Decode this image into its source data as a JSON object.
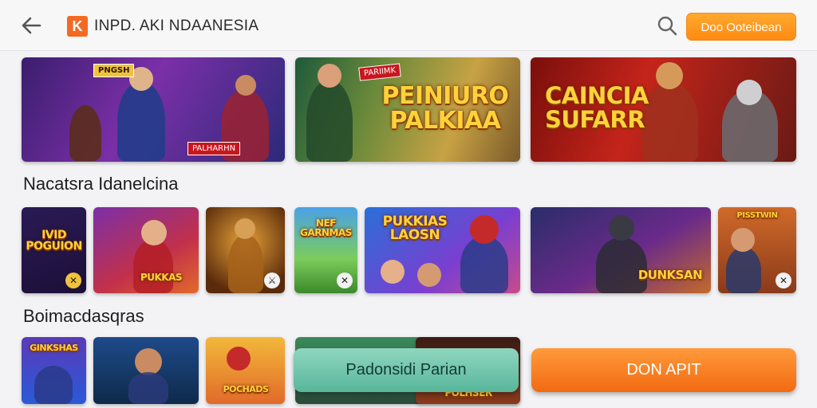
{
  "header": {
    "logo_letter": "K",
    "brand": "INPD. AKI NDAANESIA",
    "cta_label": "Doo Ooteibean"
  },
  "banners": [
    {
      "tag": "PNGSH",
      "badge": "PALHARHN"
    },
    {
      "tag": "PARIIMK",
      "title": "PEINIURO\nPALKIAA"
    },
    {
      "title": "CAINCIA\nSUFARR"
    }
  ],
  "sections": [
    {
      "title": "Nacatsra Idanelcina"
    },
    {
      "title": "Boimacdasqras"
    }
  ],
  "row2": [
    {
      "title": "IVID\nPOGUION"
    },
    {
      "title": "PUKKAS"
    },
    {
      "title": ""
    },
    {
      "title": "NEF\nGARNMAS"
    },
    {
      "title": "PUKKIAS\nLAOSN"
    },
    {
      "title": "DUNKSAN"
    },
    {
      "title": "PISSTWIN"
    }
  ],
  "row3": [
    {
      "title": "GINKSHAS"
    },
    {
      "title": ""
    },
    {
      "title": "POCHADS"
    },
    {
      "title": ""
    },
    {
      "title": "POLHSER"
    }
  ],
  "buttons": {
    "secondary": "Padonsidi Parian",
    "primary": "DON APIT"
  },
  "colors": {
    "accent": "#ff8a12",
    "teal": "#58b69a"
  },
  "icons": [
    "back-arrow-icon",
    "search-icon",
    "play-badge-icon"
  ]
}
